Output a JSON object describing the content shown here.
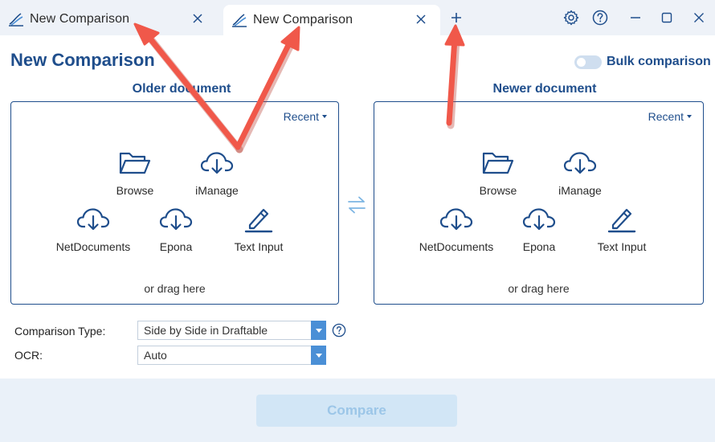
{
  "tabs": [
    {
      "label": "New Comparison",
      "active": false
    },
    {
      "label": "New Comparison",
      "active": true
    }
  ],
  "icons": {
    "app": "draftable-logo-icon",
    "close": "close-icon",
    "add_tab": "plus-icon",
    "settings": "gear-icon",
    "help": "question-circle-icon",
    "minimize": "minimize-icon",
    "maximize": "maximize-icon",
    "window_close": "close-icon",
    "folder": "folder-open-icon",
    "cloud_download": "cloud-download-icon",
    "pencil": "pencil-icon",
    "swap": "swap-arrows-icon",
    "arrow": "red-annotation-arrow"
  },
  "header": {
    "title": "New Comparison",
    "bulk_label": "Bulk comparison",
    "bulk_enabled": false
  },
  "older": {
    "heading": "Older document",
    "recent_label": "Recent",
    "sources": [
      "Browse",
      "iManage",
      "NetDocuments",
      "Epona",
      "Text Input"
    ],
    "drag_label": "or drag here"
  },
  "newer": {
    "heading": "Newer document",
    "recent_label": "Recent",
    "sources": [
      "Browse",
      "iManage",
      "NetDocuments",
      "Epona",
      "Text Input"
    ],
    "drag_label": "or drag here"
  },
  "options": {
    "comparison_type_label": "Comparison Type:",
    "comparison_type_value": "Side by Side in Draftable",
    "ocr_label": "OCR:",
    "ocr_value": "Auto"
  },
  "footer": {
    "compare_label": "Compare",
    "compare_enabled": false
  },
  "colors": {
    "brand": "#1f4e8c",
    "accent": "#4a8fd6",
    "arrow": "#f0584a",
    "tabbar_bg": "#eef2f8",
    "footer_bg": "#eaf1f9"
  }
}
